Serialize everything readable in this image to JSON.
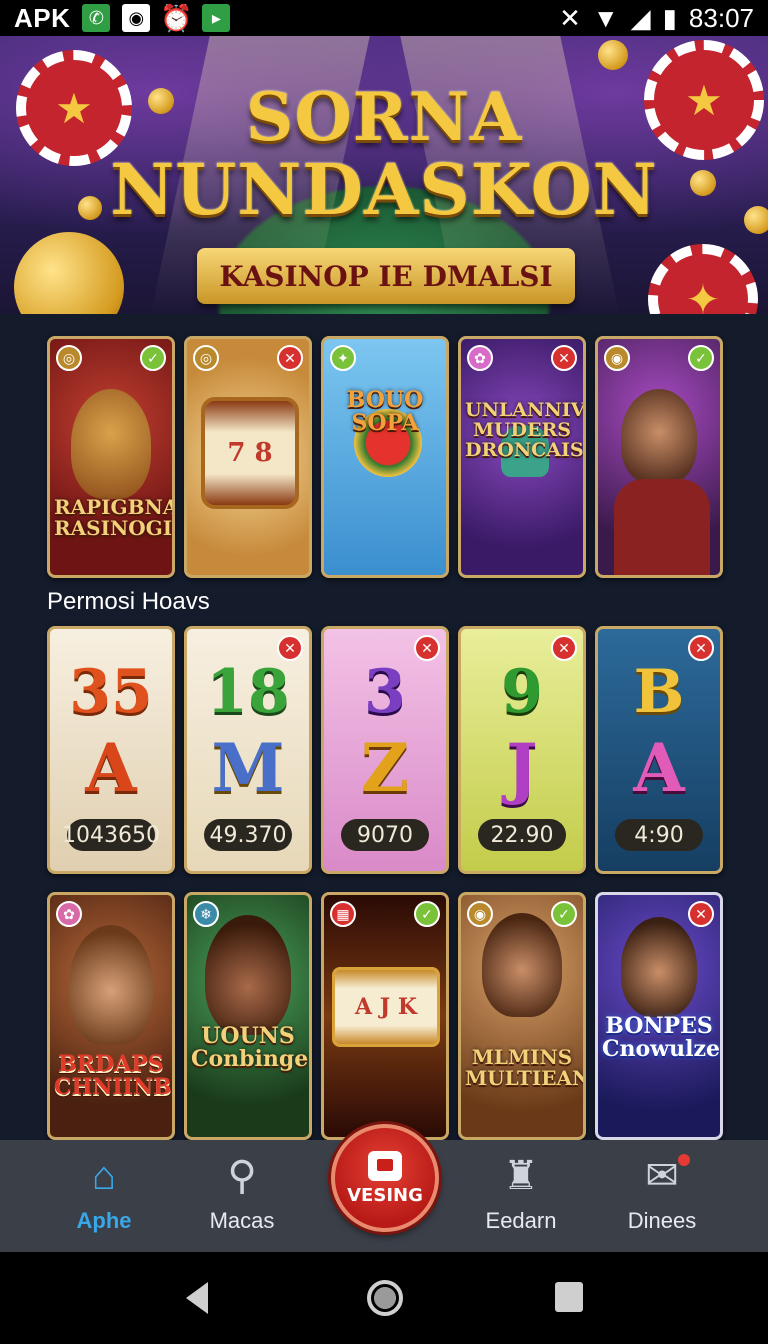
{
  "status_bar": {
    "carrier_label": "APK",
    "time": "83:07",
    "icons": [
      "whatsapp-icon",
      "camera-icon",
      "alarm-icon",
      "play-store-icon",
      "mute-icon",
      "wifi-icon",
      "signal-icon",
      "battery-icon"
    ]
  },
  "banner": {
    "title_line1": "SORNA",
    "title_line2": "NUNDASKON",
    "ribbon_text": "KASINOP IE DMALSI"
  },
  "row1": [
    {
      "title": "RAPIGBNAIS RASINOGI",
      "badge": "check",
      "bg": "#7a1a1a"
    },
    {
      "title": "",
      "badge": "close",
      "bg": "#d39a4a"
    },
    {
      "title": "BOUO SOPA",
      "badge": "none",
      "bg": "#4aa6e0"
    },
    {
      "title": "UNLANNIV MUDERS DRONCAIS",
      "badge": "close",
      "bg": "#4a2a7a"
    },
    {
      "title": "",
      "badge": "check",
      "bg": "#5a2a6a"
    }
  ],
  "section_label": "Permosi Hoavs",
  "row2": [
    {
      "top": "35",
      "letter": "A",
      "amount": "1043650",
      "bg": "#efe3cf",
      "top_color": "#e0521d",
      "letter_color": "#d8461a"
    },
    {
      "top": "18",
      "letter": "M",
      "amount": "49.370",
      "bg": "#f3e9d6",
      "top_color": "#3aa33a",
      "letter_color": "#4a6fc9"
    },
    {
      "top": "3",
      "letter": "Z",
      "amount": "9070",
      "bg": "#e9a8d8",
      "top_color": "#7a3fc1",
      "letter_color": "#e2a21c"
    },
    {
      "top": "9",
      "letter": "J",
      "amount": "22.90",
      "bg": "#d7e07a",
      "top_color": "#2f9a2f",
      "letter_color": "#b03fc4"
    },
    {
      "top": "B",
      "letter": "A",
      "amount": "4:90",
      "bg": "#1f5a86",
      "top_color": "#f0c33a",
      "letter_color": "#e05cb8"
    }
  ],
  "row3": [
    {
      "title": "BRDAPS CHNIINB",
      "badge": "none",
      "bg": "#6a3a1a"
    },
    {
      "title": "UOUNS Conbinge",
      "badge": "none",
      "bg": "#2d6a3a"
    },
    {
      "title": "",
      "badge": "check",
      "bg": "#3a1a0a"
    },
    {
      "title": "MLMINS MULTIEANEN",
      "badge": "check",
      "bg": "#a9733a"
    },
    {
      "title": "BONPES Cnowulze",
      "badge": "close",
      "bg": "#2a3a8a"
    }
  ],
  "bottom_nav": {
    "home": "Aphe",
    "search": "Macas",
    "center": "VESING",
    "earn": "Eedarn",
    "chat": "Dinees"
  },
  "colors": {
    "accent": "#39a7e8",
    "center_red": "#c92019",
    "gold": "#f5c842"
  }
}
